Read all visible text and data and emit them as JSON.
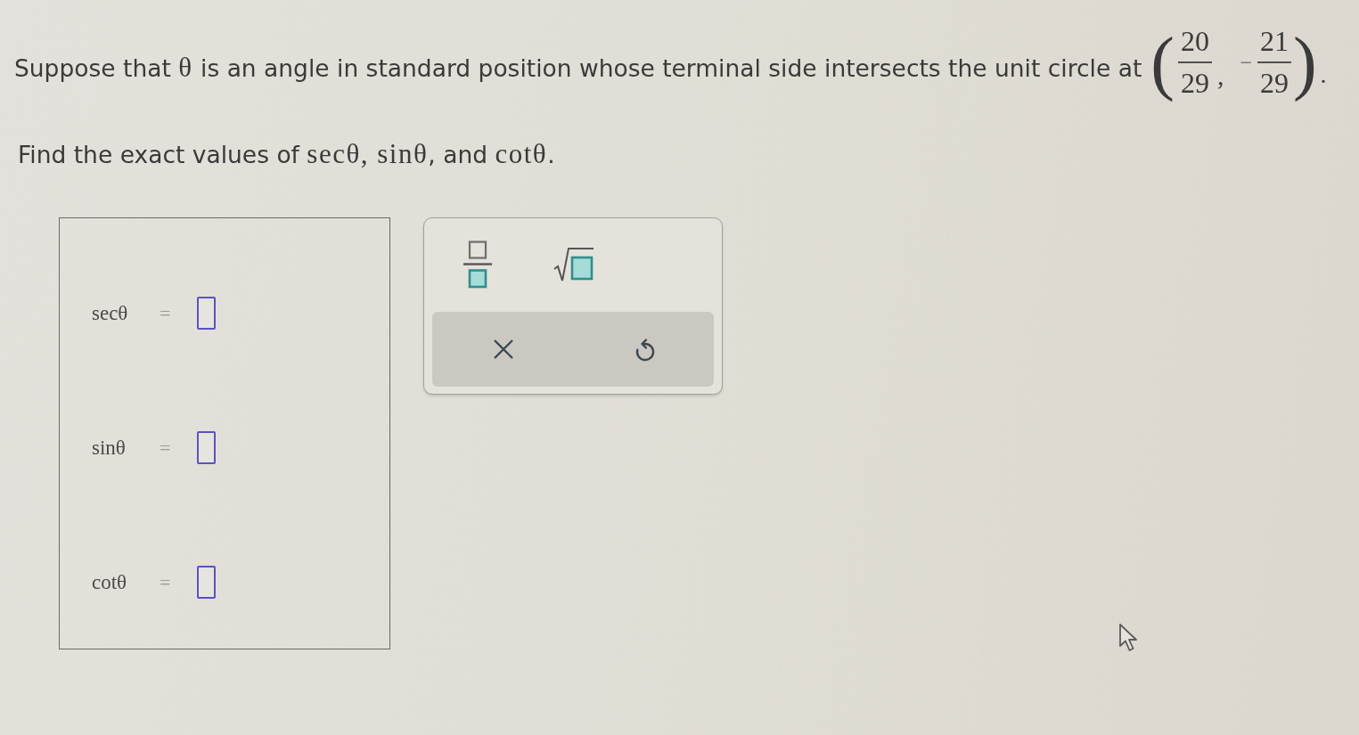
{
  "question": {
    "segments": [
      {
        "kind": "text",
        "text": "Suppose that "
      },
      {
        "kind": "math",
        "text": "θ"
      },
      {
        "kind": "text",
        "text": " is an angle in standard position whose terminal side intersects the unit circle at"
      }
    ],
    "point": {
      "open": "(",
      "x": {
        "numerator": "20",
        "denominator": "29"
      },
      "separator": ",",
      "y": {
        "sign": "−",
        "numerator": "21",
        "denominator": "29"
      },
      "close": ")"
    },
    "end": "."
  },
  "instruction": {
    "segments": [
      {
        "kind": "text",
        "text": "Find the exact values of "
      },
      {
        "kind": "math",
        "text": "secθ, sinθ"
      },
      {
        "kind": "text",
        "text": ", and "
      },
      {
        "kind": "math",
        "text": "cotθ"
      },
      {
        "kind": "text",
        "text": "."
      }
    ]
  },
  "answers": [
    {
      "label": "secθ",
      "equals": "="
    },
    {
      "label": "sinθ",
      "equals": "="
    },
    {
      "label": "cotθ",
      "equals": "="
    }
  ],
  "toolbar": {
    "templates": [
      {
        "kind": "fraction"
      },
      {
        "kind": "square_root"
      }
    ],
    "actions": [
      {
        "kind": "clear"
      },
      {
        "kind": "undo"
      }
    ]
  }
}
